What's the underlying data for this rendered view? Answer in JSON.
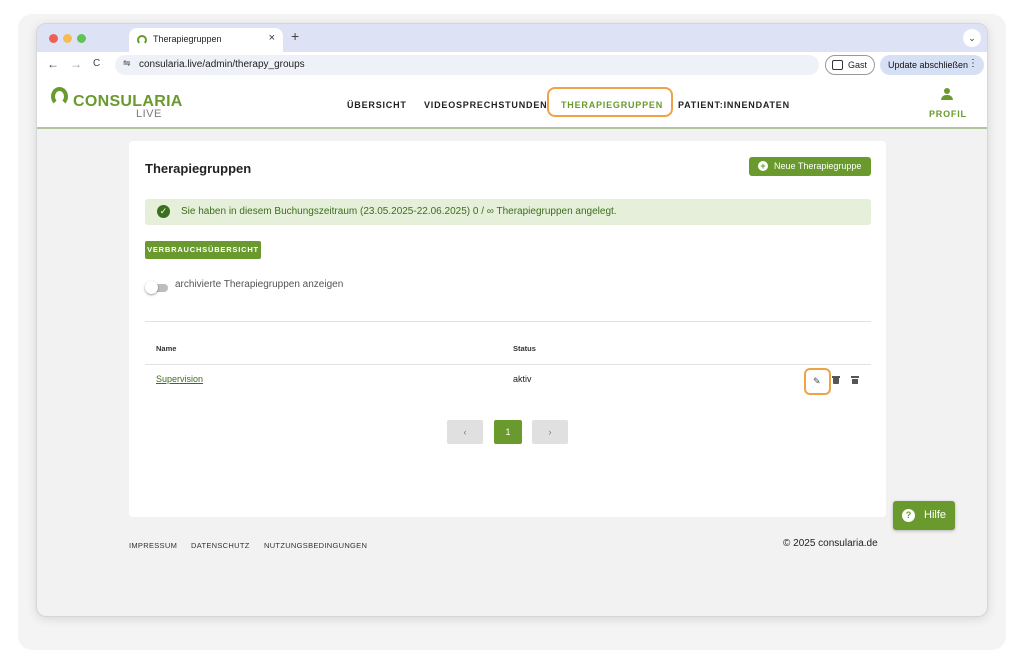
{
  "browser": {
    "tab_title": "Therapiegruppen",
    "tab_close": "×",
    "new_tab": "+",
    "tab_menu": "⌄",
    "back": "←",
    "forward": "→",
    "reload": "C",
    "url_icon": "⇋",
    "url": "consularia.live/admin/therapy_groups",
    "guest_label": "Gast",
    "update_label": "Update abschließen",
    "update_more": "⋮"
  },
  "site": {
    "logo_main": "CONSULARIA",
    "logo_sub": "LIVE",
    "nav": [
      {
        "label": "ÜBERSICHT"
      },
      {
        "label": "VIDEOSPRECHSTUNDEN"
      },
      {
        "label": "THERAPIEGRUPPEN"
      },
      {
        "label": "PATIENT:INNENDATEN"
      }
    ],
    "profile_label": "PROFIL"
  },
  "main": {
    "title": "Therapiegruppen",
    "new_button_icon": "+",
    "new_button_label": "Neue Therapiegruppe",
    "alert_icon": "✓",
    "alert_text": "Sie haben in diesem Buchungszeitraum (23.05.2025-22.06.2025) 0 / ∞ Therapiegruppen angelegt.",
    "usage_button": "VERBRAUCHSÜBERSICHT",
    "archived_toggle_label": "archivierte Therapiegruppen anzeigen",
    "table": {
      "headers": [
        "Name",
        "Status"
      ],
      "rows": [
        {
          "name": "Supervision",
          "status": "aktiv",
          "edit_icon": "✎"
        }
      ]
    },
    "pagination": {
      "prev": "‹",
      "current": "1",
      "next": "›"
    }
  },
  "footer": {
    "links": [
      "IMPRESSUM",
      "DATENSCHUTZ",
      "NUTZUNGSBEDINGUNGEN"
    ],
    "copyright": "© 2025 consularia.de"
  },
  "help": {
    "icon": "?",
    "label": "Hilfe"
  },
  "colors": {
    "brand_green": "#6a9a2e",
    "highlight_orange": "#f0a246",
    "alert_bg": "#e6efd9"
  }
}
